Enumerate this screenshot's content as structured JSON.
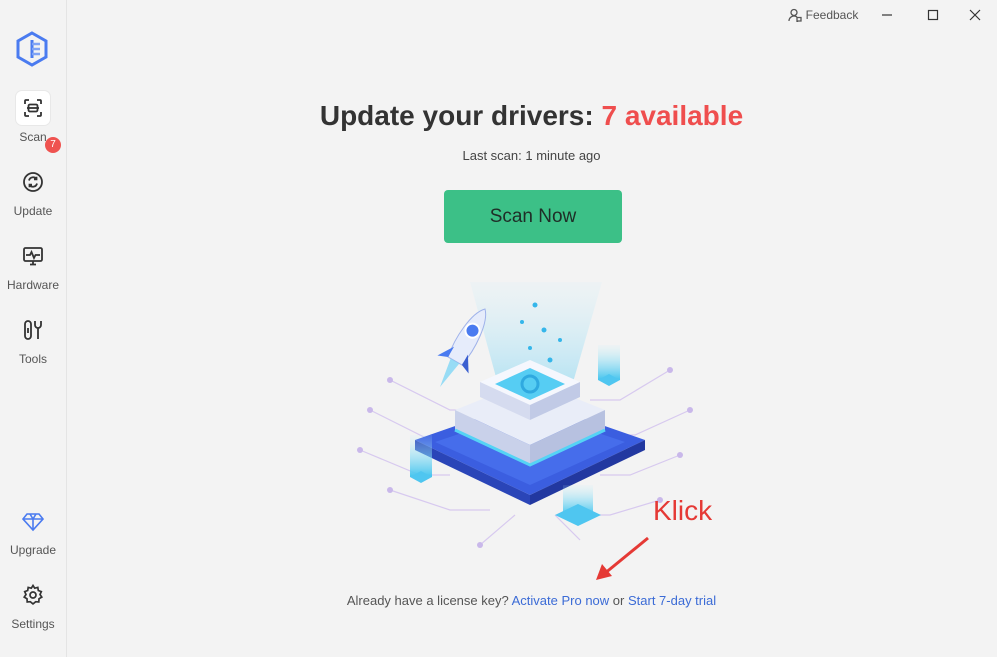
{
  "titlebar": {
    "feedback_label": "Feedback"
  },
  "sidebar": {
    "items": [
      {
        "label": "Scan",
        "icon": "scan-icon",
        "active": true
      },
      {
        "label": "Update",
        "icon": "refresh-icon",
        "badge": "7"
      },
      {
        "label": "Hardware",
        "icon": "monitor-pulse-icon"
      },
      {
        "label": "Tools",
        "icon": "tools-icon"
      },
      {
        "label": "Upgrade",
        "icon": "diamond-icon"
      },
      {
        "label": "Settings",
        "icon": "gear-icon"
      }
    ]
  },
  "main": {
    "headline_prefix": "Update your drivers:",
    "headline_count": "7 available",
    "last_scan": "Last scan: 1 minute ago",
    "scan_button": "Scan Now",
    "footer": {
      "question": "Already have a license key?",
      "activate_link": "Activate Pro now",
      "or": "or",
      "trial_link": "Start 7-day trial"
    }
  },
  "annotation": {
    "text": "Klick"
  },
  "colors": {
    "accent_green": "#3cc087",
    "alert_red": "#ef4e4e",
    "link_blue": "#3b6bd6",
    "brand_blue": "#4a7bf0"
  }
}
